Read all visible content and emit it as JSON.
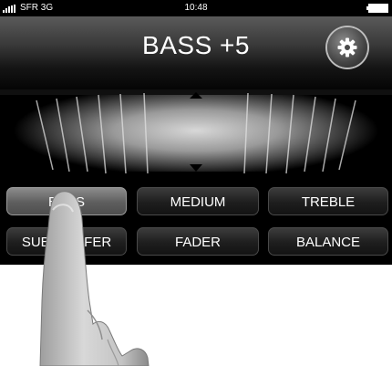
{
  "status_bar": {
    "carrier": "SFR 3G",
    "time": "10:48",
    "signal_bars": 5,
    "battery_level": 1.0
  },
  "header": {
    "title": "BASS +5",
    "settings_icon": "gear-icon"
  },
  "modes": [
    {
      "label": "BASS",
      "active": true
    },
    {
      "label": "MEDIUM",
      "active": false
    },
    {
      "label": "TREBLE",
      "active": false
    },
    {
      "label": "SUBWOOFER",
      "active": false
    },
    {
      "label": "FADER",
      "active": false
    },
    {
      "label": "BALANCE",
      "active": false
    }
  ],
  "colors": {
    "background": "#000000",
    "active_button": "#6e6e6e",
    "text": "#ffffff"
  }
}
